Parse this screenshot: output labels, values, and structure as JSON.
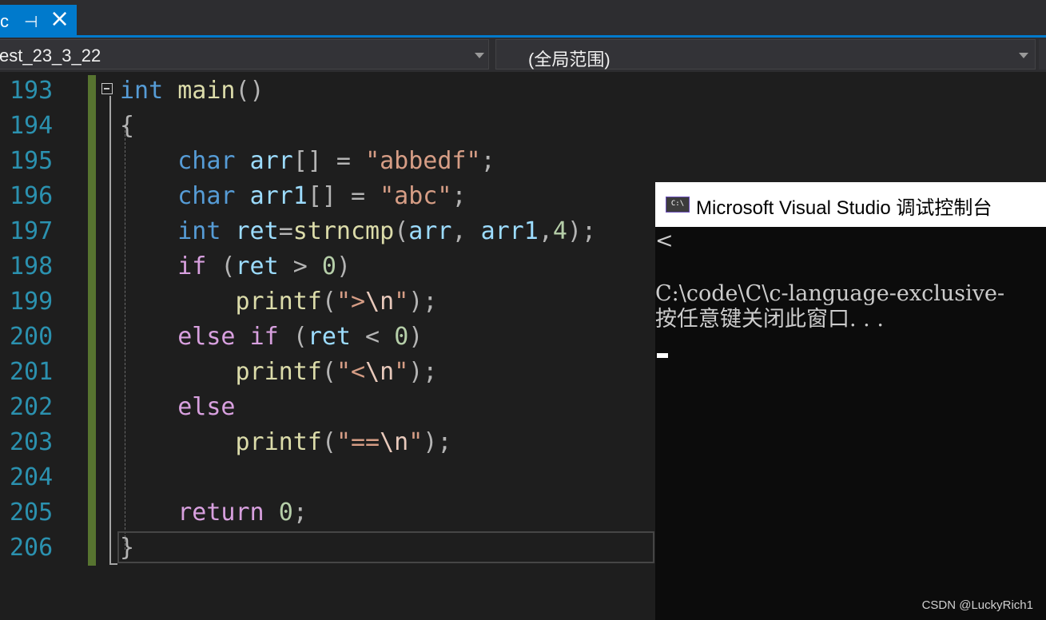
{
  "tab": {
    "label": "c",
    "pin_glyph": "⊣",
    "close_glyph": "×"
  },
  "navbar": {
    "project": "est_23_3_22",
    "scope": "(全局范围)"
  },
  "editor": {
    "line_numbers": [
      "193",
      "194",
      "195",
      "196",
      "197",
      "198",
      "199",
      "200",
      "201",
      "202",
      "203",
      "204",
      "205",
      "206"
    ],
    "code_lines": [
      [
        {
          "t": "int",
          "c": "kw"
        },
        {
          "t": " ",
          "c": ""
        },
        {
          "t": "main",
          "c": "fn"
        },
        {
          "t": "()",
          "c": "pun"
        }
      ],
      [
        {
          "t": "{",
          "c": "pun"
        }
      ],
      [
        {
          "t": "    ",
          "c": ""
        },
        {
          "t": "char",
          "c": "kw"
        },
        {
          "t": " ",
          "c": ""
        },
        {
          "t": "arr",
          "c": "var"
        },
        {
          "t": "[] = ",
          "c": "pun"
        },
        {
          "t": "\"abbedf\"",
          "c": "str"
        },
        {
          "t": ";",
          "c": "pun"
        }
      ],
      [
        {
          "t": "    ",
          "c": ""
        },
        {
          "t": "char",
          "c": "kw"
        },
        {
          "t": " ",
          "c": ""
        },
        {
          "t": "arr1",
          "c": "var"
        },
        {
          "t": "[] = ",
          "c": "pun"
        },
        {
          "t": "\"abc\"",
          "c": "str"
        },
        {
          "t": ";",
          "c": "pun"
        }
      ],
      [
        {
          "t": "    ",
          "c": ""
        },
        {
          "t": "int",
          "c": "kw"
        },
        {
          "t": " ",
          "c": ""
        },
        {
          "t": "ret",
          "c": "var"
        },
        {
          "t": "=",
          "c": "pun"
        },
        {
          "t": "strncmp",
          "c": "fn"
        },
        {
          "t": "(",
          "c": "pun"
        },
        {
          "t": "arr",
          "c": "var"
        },
        {
          "t": ", ",
          "c": "pun"
        },
        {
          "t": "arr1",
          "c": "var"
        },
        {
          "t": ",",
          "c": "pun"
        },
        {
          "t": "4",
          "c": "num"
        },
        {
          "t": ");",
          "c": "pun"
        }
      ],
      [
        {
          "t": "    ",
          "c": ""
        },
        {
          "t": "if",
          "c": "ctl"
        },
        {
          "t": " (",
          "c": "pun"
        },
        {
          "t": "ret",
          "c": "var"
        },
        {
          "t": " > ",
          "c": "pun"
        },
        {
          "t": "0",
          "c": "num"
        },
        {
          "t": ")",
          "c": "pun"
        }
      ],
      [
        {
          "t": "        ",
          "c": ""
        },
        {
          "t": "printf",
          "c": "fn"
        },
        {
          "t": "(",
          "c": "pun"
        },
        {
          "t": "\">",
          "c": "str"
        },
        {
          "t": "\\n",
          "c": "esc"
        },
        {
          "t": "\"",
          "c": "str"
        },
        {
          "t": ");",
          "c": "pun"
        }
      ],
      [
        {
          "t": "    ",
          "c": ""
        },
        {
          "t": "else",
          "c": "ctl"
        },
        {
          "t": " ",
          "c": ""
        },
        {
          "t": "if",
          "c": "ctl"
        },
        {
          "t": " (",
          "c": "pun"
        },
        {
          "t": "ret",
          "c": "var"
        },
        {
          "t": " < ",
          "c": "pun"
        },
        {
          "t": "0",
          "c": "num"
        },
        {
          "t": ")",
          "c": "pun"
        }
      ],
      [
        {
          "t": "        ",
          "c": ""
        },
        {
          "t": "printf",
          "c": "fn"
        },
        {
          "t": "(",
          "c": "pun"
        },
        {
          "t": "\"<",
          "c": "str"
        },
        {
          "t": "\\n",
          "c": "esc"
        },
        {
          "t": "\"",
          "c": "str"
        },
        {
          "t": ");",
          "c": "pun"
        }
      ],
      [
        {
          "t": "    ",
          "c": ""
        },
        {
          "t": "else",
          "c": "ctl"
        }
      ],
      [
        {
          "t": "        ",
          "c": ""
        },
        {
          "t": "printf",
          "c": "fn"
        },
        {
          "t": "(",
          "c": "pun"
        },
        {
          "t": "\"==",
          "c": "str"
        },
        {
          "t": "\\n",
          "c": "esc"
        },
        {
          "t": "\"",
          "c": "str"
        },
        {
          "t": ");",
          "c": "pun"
        }
      ],
      [],
      [
        {
          "t": "    ",
          "c": ""
        },
        {
          "t": "return",
          "c": "ctl"
        },
        {
          "t": " ",
          "c": ""
        },
        {
          "t": "0",
          "c": "num"
        },
        {
          "t": ";",
          "c": "pun"
        }
      ],
      [
        {
          "t": "}",
          "c": "pun"
        }
      ]
    ]
  },
  "console": {
    "icon_text": "C:\\",
    "title": "Microsoft Visual Studio 调试控制台",
    "lines": [
      "<",
      "",
      "C:\\code\\C\\c-language-exclusive-",
      "按任意键关闭此窗口. . ."
    ]
  },
  "watermark": "CSDN @LuckyRich1",
  "colors": {
    "accent": "#007acc",
    "keyword": "#569cd6",
    "control": "#d8a0df",
    "function": "#dcdcaa",
    "variable": "#9cdcfe",
    "string": "#d69d85",
    "number": "#b5cea8",
    "line_number": "#2b91af",
    "change_bar": "#577430"
  }
}
